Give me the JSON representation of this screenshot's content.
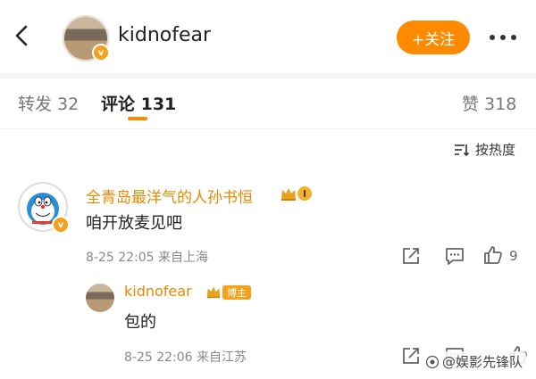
{
  "header": {
    "username": "kidnofear",
    "follow_label": "+关注"
  },
  "tabs": [
    {
      "label": "转发 32"
    },
    {
      "label": "评论 131"
    },
    {
      "label": "赞 318"
    }
  ],
  "sort_label": "按热度",
  "comments": [
    {
      "name": "全青岛最洋气的人孙书恒",
      "rank": "I",
      "text": "咱开放麦见吧",
      "meta": "8-25 22:05  来自上海",
      "likes": "9"
    }
  ],
  "reply": {
    "name": "kidnofear",
    "badge": "博主",
    "text": "包的",
    "meta": "8-25 22:06  来自江苏"
  },
  "watermark": "@娱影先锋队",
  "colors": {
    "accent": "#ff8a00",
    "username_orange": "#e58a00",
    "badge_gold": "#f3b12d"
  }
}
